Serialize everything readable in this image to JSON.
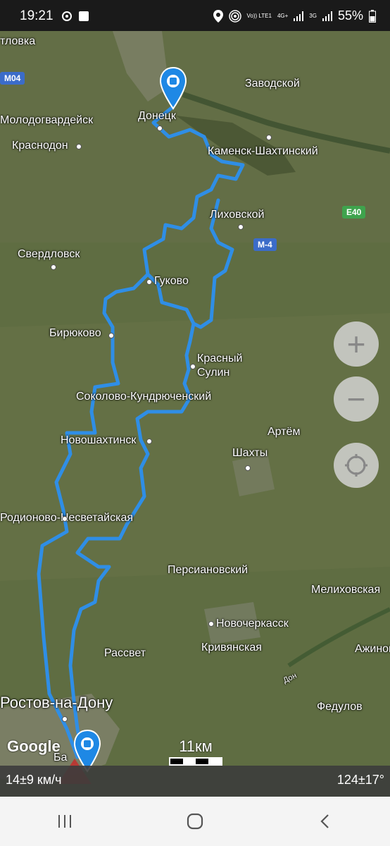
{
  "status": {
    "time": "19:21",
    "volte": "Vo)) LTE1",
    "net1": "4G+",
    "net2": "3G",
    "battery": "55%"
  },
  "map": {
    "places": [
      {
        "name": "тловка"
      },
      {
        "name": "Заводской"
      },
      {
        "name": "Донецк"
      },
      {
        "name": "Молодогвардейск"
      },
      {
        "name": "Краснодон"
      },
      {
        "name": "Каменск-Шахтинский"
      },
      {
        "name": "Лиховской"
      },
      {
        "name": "Свердловск"
      },
      {
        "name": "Гуково"
      },
      {
        "name": "Бирюково"
      },
      {
        "name": "Красный"
      },
      {
        "name": "Сулин"
      },
      {
        "name": "Соколово-Кундрюченский"
      },
      {
        "name": "Новошахтинск"
      },
      {
        "name": "Артём"
      },
      {
        "name": "Шахты"
      },
      {
        "name": "Родионово-Несветайская"
      },
      {
        "name": "Персиановский"
      },
      {
        "name": "Мелиховская"
      },
      {
        "name": "Новочеркасск"
      },
      {
        "name": "Кривянская"
      },
      {
        "name": "Рассвет"
      },
      {
        "name": "Ажинов"
      },
      {
        "name": "Ростов-на-Дону"
      },
      {
        "name": "Федулов"
      },
      {
        "name": "Ба"
      },
      {
        "name": "Дон"
      }
    ],
    "road_badges": {
      "m04": "M04",
      "e40": "E40",
      "m4": "M-4"
    },
    "google_label": "Google",
    "scale_label": "11км"
  },
  "controls": {
    "zoom_in": "+",
    "zoom_out": "−"
  },
  "info": {
    "speed": "14±9 км/ч",
    "heading": "124±17°"
  },
  "colors": {
    "route": "#2f8ee6",
    "marker": "#1e88e5"
  }
}
